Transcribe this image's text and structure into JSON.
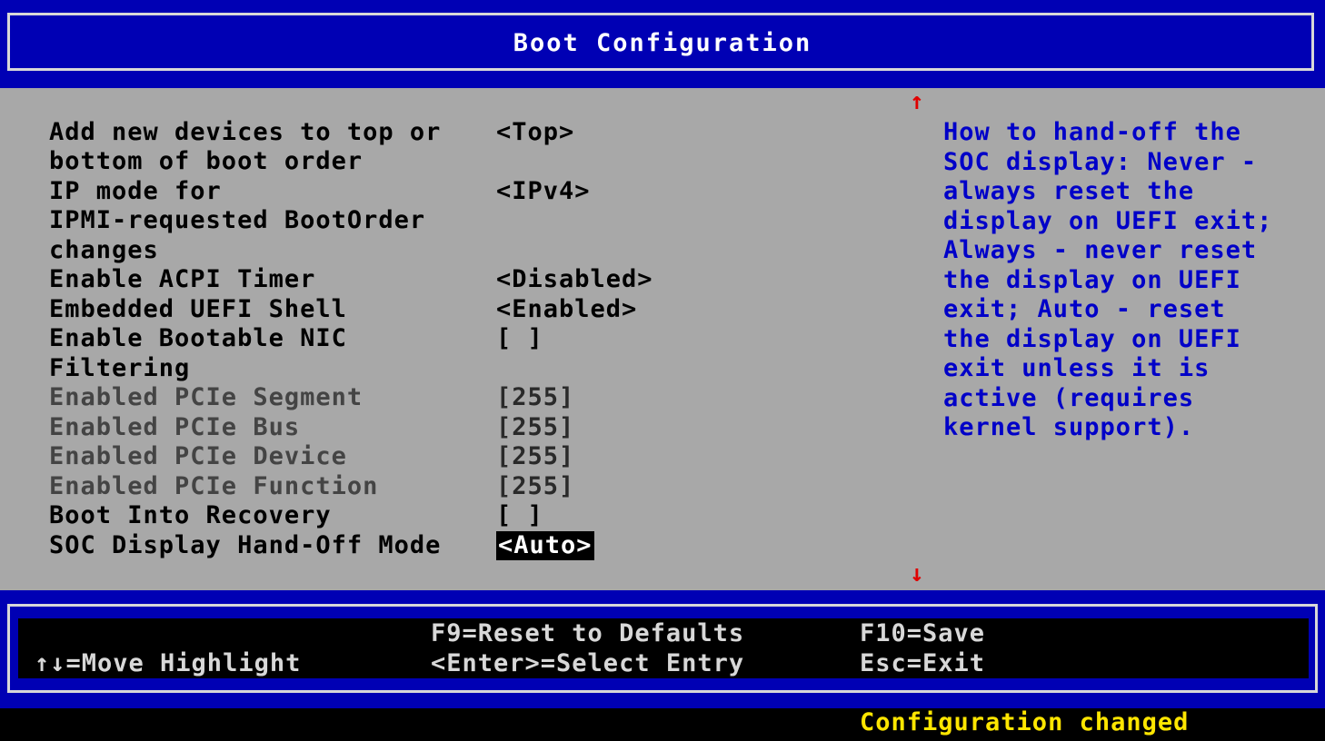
{
  "header": {
    "title": "Boot Configuration"
  },
  "settings": [
    {
      "label_lines": [
        "Add new devices to top or",
        "bottom of boot order"
      ],
      "value": "<Top>"
    },
    {
      "label_lines": [
        "IP mode for",
        "IPMI-requested BootOrder",
        "changes"
      ],
      "value": "<IPv4>"
    },
    {
      "label_lines": [
        "Enable ACPI Timer"
      ],
      "value": "<Disabled>"
    },
    {
      "label_lines": [
        "Embedded UEFI Shell"
      ],
      "value": "<Enabled>"
    },
    {
      "label_lines": [
        "Enable Bootable NIC",
        "Filtering"
      ],
      "value": "[ ]"
    },
    {
      "label_lines": [
        "Enabled PCIe Segment"
      ],
      "value": "[255]"
    },
    {
      "label_lines": [
        "Enabled PCIe Bus"
      ],
      "value": "[255]"
    },
    {
      "label_lines": [
        "Enabled PCIe Device"
      ],
      "value": "[255]"
    },
    {
      "label_lines": [
        "Enabled PCIe Function"
      ],
      "value": "[255]"
    },
    {
      "label_lines": [
        "Boot Into Recovery"
      ],
      "value": "[ ]"
    },
    {
      "label_lines": [
        "SOC Display Hand-Off Mode"
      ],
      "value": "<Auto>"
    }
  ],
  "scroll": {
    "up_arrow": "↑",
    "down_arrow": "↓"
  },
  "help_lines": [
    "How to hand-off the",
    "SOC display: Never -",
    "always reset the",
    "display on UEFI exit;",
    "Always - never reset",
    "the display on UEFI",
    "exit; Auto - reset",
    "the display on UEFI",
    "exit unless it is",
    "active (requires",
    "kernel support)."
  ],
  "footer": {
    "move": "↑↓=Move Highlight",
    "reset": "F9=Reset to Defaults",
    "select": "<Enter>=Select Entry",
    "save": "F10=Save",
    "exit": "Esc=Exit"
  },
  "status": "Configuration changed",
  "colors": {
    "header_bg": "#0000b4",
    "body_bg": "#a8a8a8",
    "help_text": "#0000c8",
    "status_text": "#ffe600",
    "scroll_arrow": "#e00000"
  }
}
